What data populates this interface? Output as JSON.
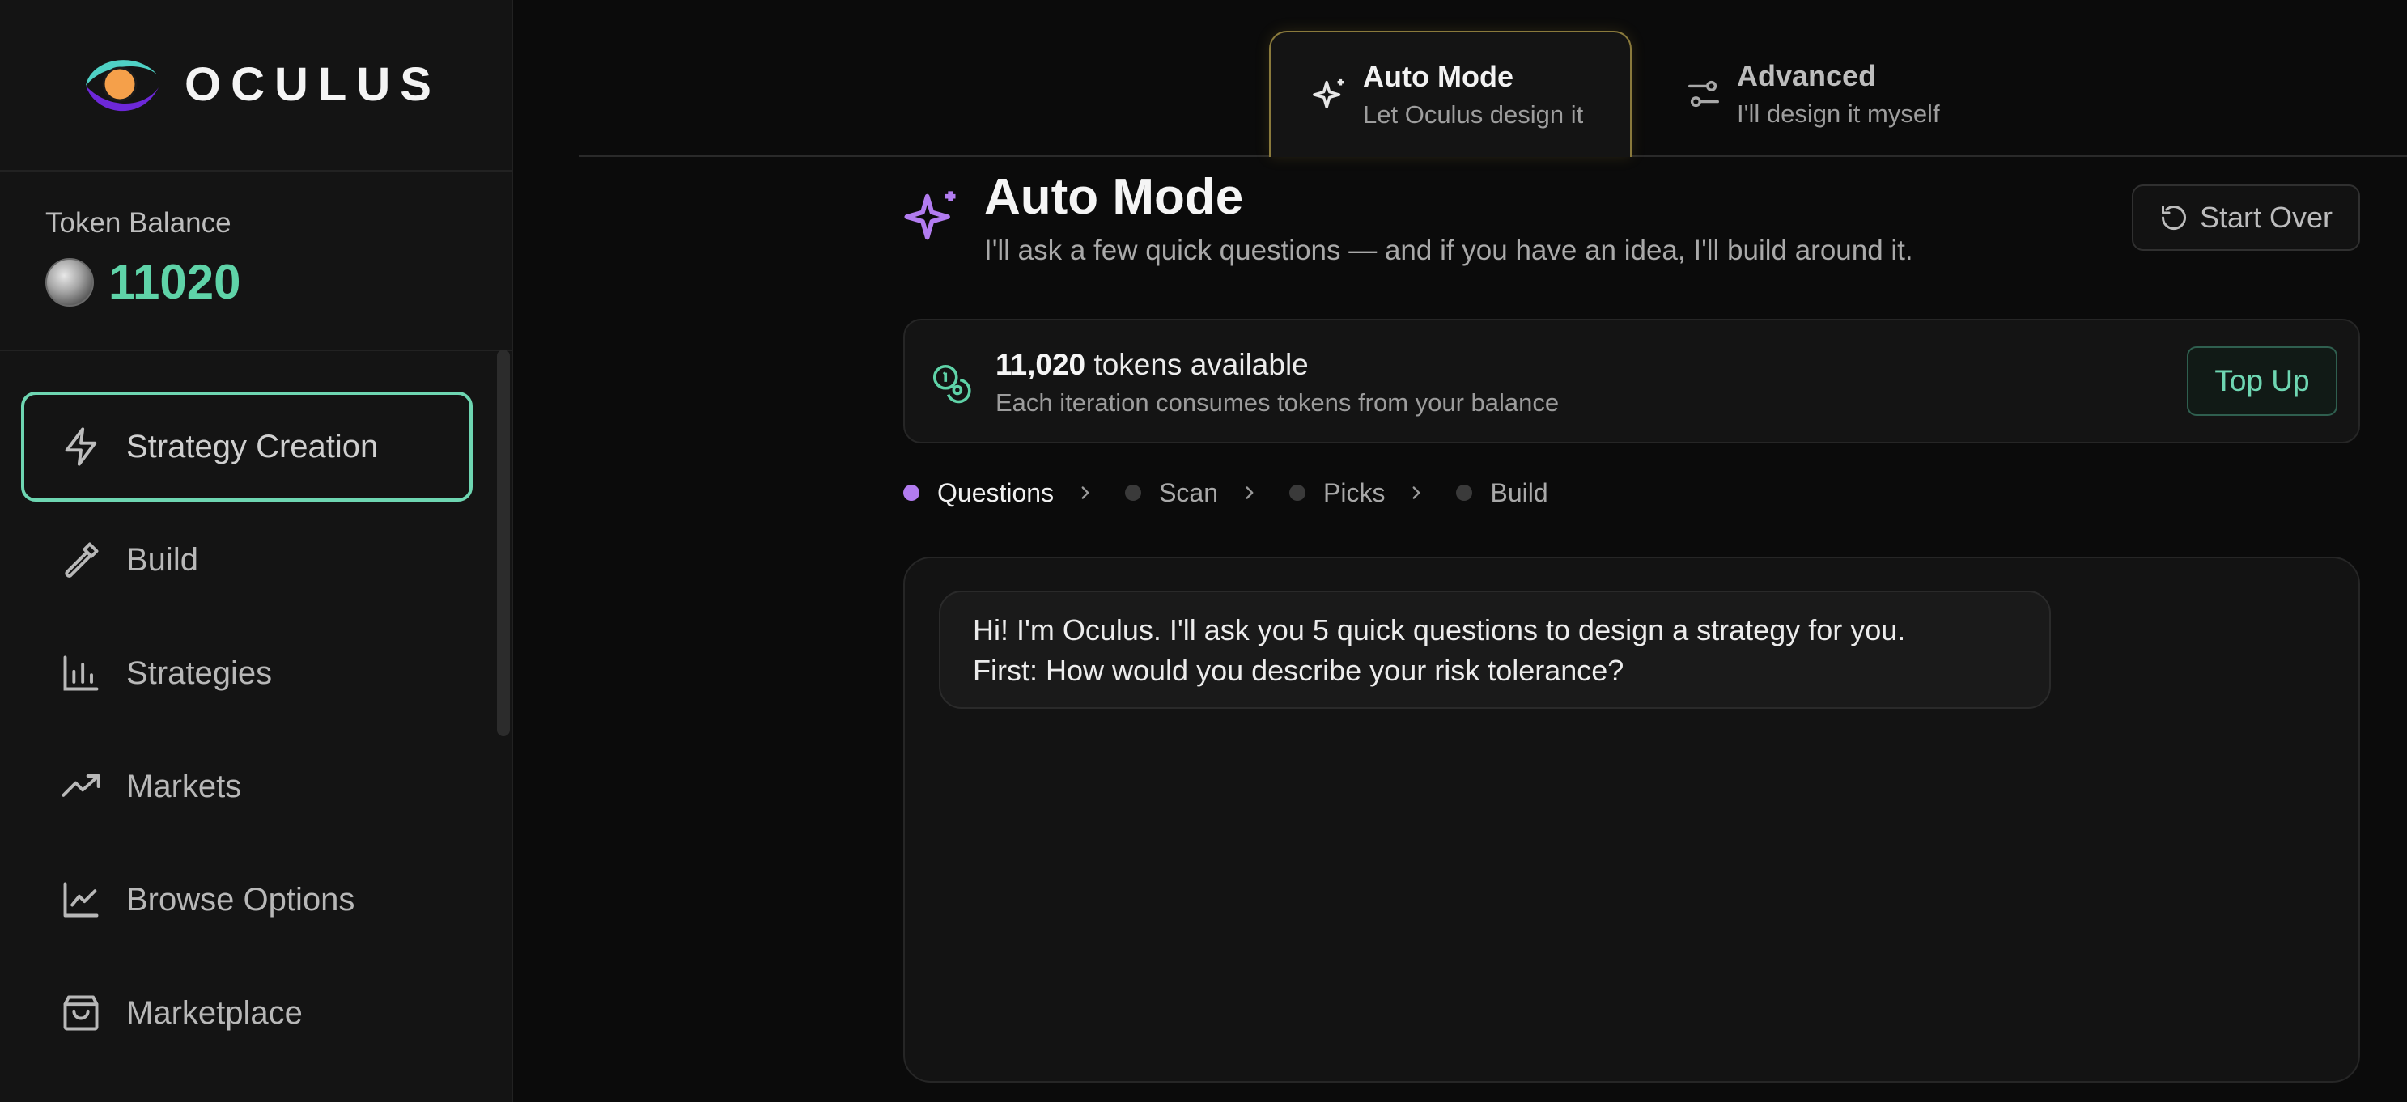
{
  "brand": {
    "name": "OCULUS"
  },
  "sidebar": {
    "balance_label": "Token Balance",
    "balance_value": "11020",
    "items": [
      {
        "label": "Strategy Creation",
        "icon": "lightning-icon",
        "active": true
      },
      {
        "label": "Build",
        "icon": "hammer-icon"
      },
      {
        "label": "Strategies",
        "icon": "bar-chart-icon"
      },
      {
        "label": "Markets",
        "icon": "trending-up-icon"
      },
      {
        "label": "Browse Options",
        "icon": "line-chart-icon"
      },
      {
        "label": "Marketplace",
        "icon": "shopping-bag-icon"
      }
    ]
  },
  "modes": {
    "auto": {
      "title": "Auto Mode",
      "subtitle": "Let Oculus design it",
      "icon": "sparkle-icon"
    },
    "advanced": {
      "title": "Advanced",
      "subtitle": "I'll design it myself",
      "icon": "sliders-icon"
    }
  },
  "header": {
    "title": "Auto Mode",
    "subtitle": "I'll ask a few quick questions — and if you have an idea, I'll build around it.",
    "start_over": "Start Over"
  },
  "tokens": {
    "count": "11,020",
    "label": " tokens available",
    "note": "Each iteration consumes tokens from your balance",
    "top_up": "Top Up"
  },
  "steps": [
    {
      "label": "Questions",
      "active": true
    },
    {
      "label": "Scan"
    },
    {
      "label": "Picks"
    },
    {
      "label": "Build"
    }
  ],
  "chat": {
    "message_line1": "Hi! I'm Oculus. I'll ask you 5 quick questions to design a strategy for you.",
    "message_line2": "First: How would you describe your risk tolerance?"
  },
  "colors": {
    "accent_green": "#6ed6b2",
    "balance_green": "#5fd3a8",
    "accent_purple": "#b27cf0",
    "auto_tab_border": "#8a7a3c"
  }
}
